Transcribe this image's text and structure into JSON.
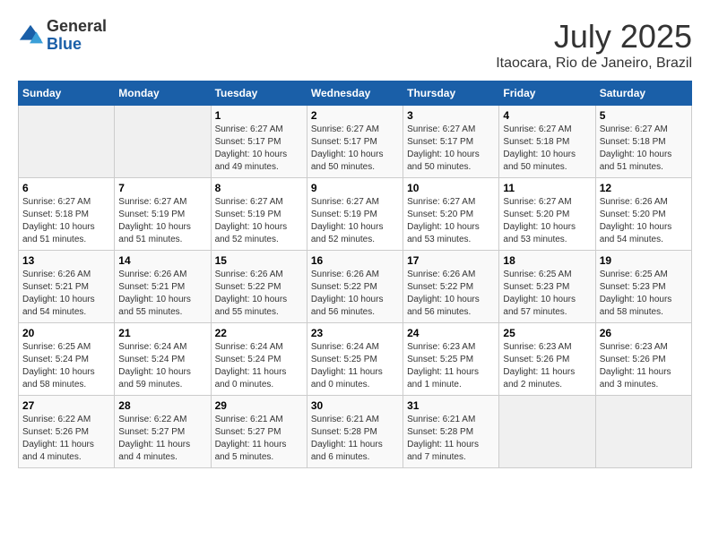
{
  "header": {
    "logo_general": "General",
    "logo_blue": "Blue",
    "month_year": "July 2025",
    "location": "Itaocara, Rio de Janeiro, Brazil"
  },
  "days_of_week": [
    "Sunday",
    "Monday",
    "Tuesday",
    "Wednesday",
    "Thursday",
    "Friday",
    "Saturday"
  ],
  "weeks": [
    [
      {
        "day": "",
        "empty": true
      },
      {
        "day": "",
        "empty": true
      },
      {
        "day": "1",
        "sunrise": "Sunrise: 6:27 AM",
        "sunset": "Sunset: 5:17 PM",
        "daylight": "Daylight: 10 hours and 49 minutes."
      },
      {
        "day": "2",
        "sunrise": "Sunrise: 6:27 AM",
        "sunset": "Sunset: 5:17 PM",
        "daylight": "Daylight: 10 hours and 50 minutes."
      },
      {
        "day": "3",
        "sunrise": "Sunrise: 6:27 AM",
        "sunset": "Sunset: 5:17 PM",
        "daylight": "Daylight: 10 hours and 50 minutes."
      },
      {
        "day": "4",
        "sunrise": "Sunrise: 6:27 AM",
        "sunset": "Sunset: 5:18 PM",
        "daylight": "Daylight: 10 hours and 50 minutes."
      },
      {
        "day": "5",
        "sunrise": "Sunrise: 6:27 AM",
        "sunset": "Sunset: 5:18 PM",
        "daylight": "Daylight: 10 hours and 51 minutes."
      }
    ],
    [
      {
        "day": "6",
        "sunrise": "Sunrise: 6:27 AM",
        "sunset": "Sunset: 5:18 PM",
        "daylight": "Daylight: 10 hours and 51 minutes."
      },
      {
        "day": "7",
        "sunrise": "Sunrise: 6:27 AM",
        "sunset": "Sunset: 5:19 PM",
        "daylight": "Daylight: 10 hours and 51 minutes."
      },
      {
        "day": "8",
        "sunrise": "Sunrise: 6:27 AM",
        "sunset": "Sunset: 5:19 PM",
        "daylight": "Daylight: 10 hours and 52 minutes."
      },
      {
        "day": "9",
        "sunrise": "Sunrise: 6:27 AM",
        "sunset": "Sunset: 5:19 PM",
        "daylight": "Daylight: 10 hours and 52 minutes."
      },
      {
        "day": "10",
        "sunrise": "Sunrise: 6:27 AM",
        "sunset": "Sunset: 5:20 PM",
        "daylight": "Daylight: 10 hours and 53 minutes."
      },
      {
        "day": "11",
        "sunrise": "Sunrise: 6:27 AM",
        "sunset": "Sunset: 5:20 PM",
        "daylight": "Daylight: 10 hours and 53 minutes."
      },
      {
        "day": "12",
        "sunrise": "Sunrise: 6:26 AM",
        "sunset": "Sunset: 5:20 PM",
        "daylight": "Daylight: 10 hours and 54 minutes."
      }
    ],
    [
      {
        "day": "13",
        "sunrise": "Sunrise: 6:26 AM",
        "sunset": "Sunset: 5:21 PM",
        "daylight": "Daylight: 10 hours and 54 minutes."
      },
      {
        "day": "14",
        "sunrise": "Sunrise: 6:26 AM",
        "sunset": "Sunset: 5:21 PM",
        "daylight": "Daylight: 10 hours and 55 minutes."
      },
      {
        "day": "15",
        "sunrise": "Sunrise: 6:26 AM",
        "sunset": "Sunset: 5:22 PM",
        "daylight": "Daylight: 10 hours and 55 minutes."
      },
      {
        "day": "16",
        "sunrise": "Sunrise: 6:26 AM",
        "sunset": "Sunset: 5:22 PM",
        "daylight": "Daylight: 10 hours and 56 minutes."
      },
      {
        "day": "17",
        "sunrise": "Sunrise: 6:26 AM",
        "sunset": "Sunset: 5:22 PM",
        "daylight": "Daylight: 10 hours and 56 minutes."
      },
      {
        "day": "18",
        "sunrise": "Sunrise: 6:25 AM",
        "sunset": "Sunset: 5:23 PM",
        "daylight": "Daylight: 10 hours and 57 minutes."
      },
      {
        "day": "19",
        "sunrise": "Sunrise: 6:25 AM",
        "sunset": "Sunset: 5:23 PM",
        "daylight": "Daylight: 10 hours and 58 minutes."
      }
    ],
    [
      {
        "day": "20",
        "sunrise": "Sunrise: 6:25 AM",
        "sunset": "Sunset: 5:24 PM",
        "daylight": "Daylight: 10 hours and 58 minutes."
      },
      {
        "day": "21",
        "sunrise": "Sunrise: 6:24 AM",
        "sunset": "Sunset: 5:24 PM",
        "daylight": "Daylight: 10 hours and 59 minutes."
      },
      {
        "day": "22",
        "sunrise": "Sunrise: 6:24 AM",
        "sunset": "Sunset: 5:24 PM",
        "daylight": "Daylight: 11 hours and 0 minutes."
      },
      {
        "day": "23",
        "sunrise": "Sunrise: 6:24 AM",
        "sunset": "Sunset: 5:25 PM",
        "daylight": "Daylight: 11 hours and 0 minutes."
      },
      {
        "day": "24",
        "sunrise": "Sunrise: 6:23 AM",
        "sunset": "Sunset: 5:25 PM",
        "daylight": "Daylight: 11 hours and 1 minute."
      },
      {
        "day": "25",
        "sunrise": "Sunrise: 6:23 AM",
        "sunset": "Sunset: 5:26 PM",
        "daylight": "Daylight: 11 hours and 2 minutes."
      },
      {
        "day": "26",
        "sunrise": "Sunrise: 6:23 AM",
        "sunset": "Sunset: 5:26 PM",
        "daylight": "Daylight: 11 hours and 3 minutes."
      }
    ],
    [
      {
        "day": "27",
        "sunrise": "Sunrise: 6:22 AM",
        "sunset": "Sunset: 5:26 PM",
        "daylight": "Daylight: 11 hours and 4 minutes."
      },
      {
        "day": "28",
        "sunrise": "Sunrise: 6:22 AM",
        "sunset": "Sunset: 5:27 PM",
        "daylight": "Daylight: 11 hours and 4 minutes."
      },
      {
        "day": "29",
        "sunrise": "Sunrise: 6:21 AM",
        "sunset": "Sunset: 5:27 PM",
        "daylight": "Daylight: 11 hours and 5 minutes."
      },
      {
        "day": "30",
        "sunrise": "Sunrise: 6:21 AM",
        "sunset": "Sunset: 5:28 PM",
        "daylight": "Daylight: 11 hours and 6 minutes."
      },
      {
        "day": "31",
        "sunrise": "Sunrise: 6:21 AM",
        "sunset": "Sunset: 5:28 PM",
        "daylight": "Daylight: 11 hours and 7 minutes."
      },
      {
        "day": "",
        "empty": true
      },
      {
        "day": "",
        "empty": true
      }
    ]
  ]
}
